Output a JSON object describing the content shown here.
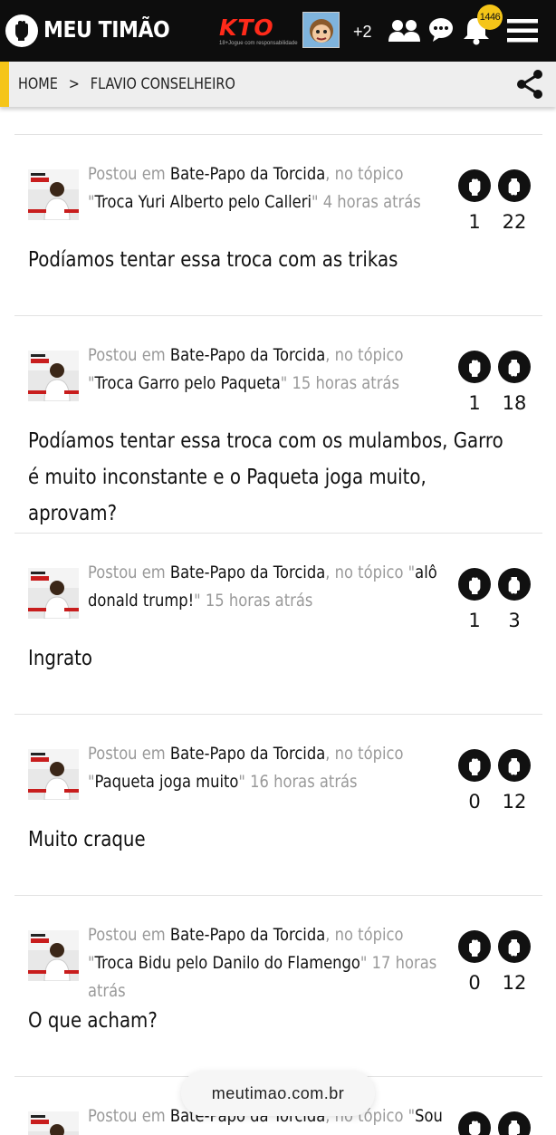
{
  "header": {
    "title": "MEU TIMÃO",
    "sponsor_name": "KTO",
    "sponsor_tag": "18+Jogue com responsabilidade",
    "extra_count": "+2",
    "notifications": "1446",
    "icons": [
      "fist-logo-icon",
      "users-icon",
      "chat-icon",
      "bell-icon",
      "menu-icon"
    ],
    "bg_color": "#0d0d0d",
    "accent_color": "#f5c518"
  },
  "breadcrumb": {
    "home": "HOME",
    "separator": ">",
    "current": "FLAVIO CONSELHEIRO"
  },
  "posts": [
    {
      "prefix": "Postou em ",
      "forum": "Bate-Papo da Torcida",
      "mid": ", no tópico \"",
      "topic": "Troca Yuri Alberto pelo Calleri",
      "suffix": "\"",
      "time": "4 horas atrás",
      "up": "1",
      "down": "22",
      "text": "Podíamos tentar essa troca com as trikas"
    },
    {
      "prefix": "Postou em ",
      "forum": "Bate-Papo da Torcida",
      "mid": ", no tópico \"",
      "topic": "Troca Garro pelo Paqueta",
      "suffix": "\"",
      "time": "15 horas atrás",
      "up": "1",
      "down": "18",
      "text": "Podíamos tentar essa troca com os mulambos, Garro é muito inconstante e o Paqueta joga muito, aprovam?"
    },
    {
      "prefix": "Postou em ",
      "forum": "Bate-Papo da Torcida",
      "mid": ", no tópico \"",
      "topic": "alô donald trump!",
      "suffix": "\"",
      "time": "15 horas atrás",
      "up": "1",
      "down": "3",
      "text": "Ingrato"
    },
    {
      "prefix": "Postou em ",
      "forum": "Bate-Papo da Torcida",
      "mid": ", no tópico \"",
      "topic": "Paqueta joga muito",
      "suffix": "\"",
      "time": "16 horas atrás",
      "up": "0",
      "down": "12",
      "text": "Muito craque"
    },
    {
      "prefix": "Postou em ",
      "forum": "Bate-Papo da Torcida",
      "mid": ", no tópico \"",
      "topic": "Troca Bidu pelo Danilo do Flamengo",
      "suffix": "\"",
      "time": "17 horas atrás",
      "up": "0",
      "down": "12",
      "text": "O que acham?"
    },
    {
      "prefix": "Postou em ",
      "forum": "Bate-Papo da Torcida",
      "mid": ", no tópico \"",
      "topic": "Sou",
      "suffix": "",
      "time": "",
      "up": "",
      "down": "",
      "text": ""
    }
  ],
  "browser": {
    "url": "meutimao.com.br"
  }
}
